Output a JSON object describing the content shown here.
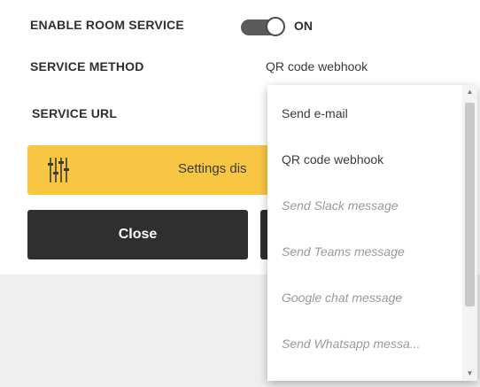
{
  "settings": {
    "enable_room_service_label": "ENABLE ROOM SERVICE",
    "toggle_state": "ON",
    "service_method_label": "SERVICE METHOD",
    "service_method_value": "QR code webhook",
    "service_url_label": "SERVICE URL"
  },
  "banner": {
    "icon": "sliders-icon",
    "text": "Settings dis",
    "color": "#f7c744"
  },
  "buttons": {
    "close_label": "Close"
  },
  "dropdown": {
    "options": [
      {
        "label": "Send e-mail",
        "enabled": true
      },
      {
        "label": "QR code webhook",
        "enabled": true
      },
      {
        "label": "Send Slack message",
        "enabled": false
      },
      {
        "label": "Send Teams message",
        "enabled": false
      },
      {
        "label": "Google chat message",
        "enabled": false
      },
      {
        "label": "Send Whatsapp messa...",
        "enabled": false
      }
    ]
  },
  "colors": {
    "dark_button": "#2f2f2f",
    "toggle_on": "#5a5a5a",
    "background_lower": "#efefef"
  }
}
